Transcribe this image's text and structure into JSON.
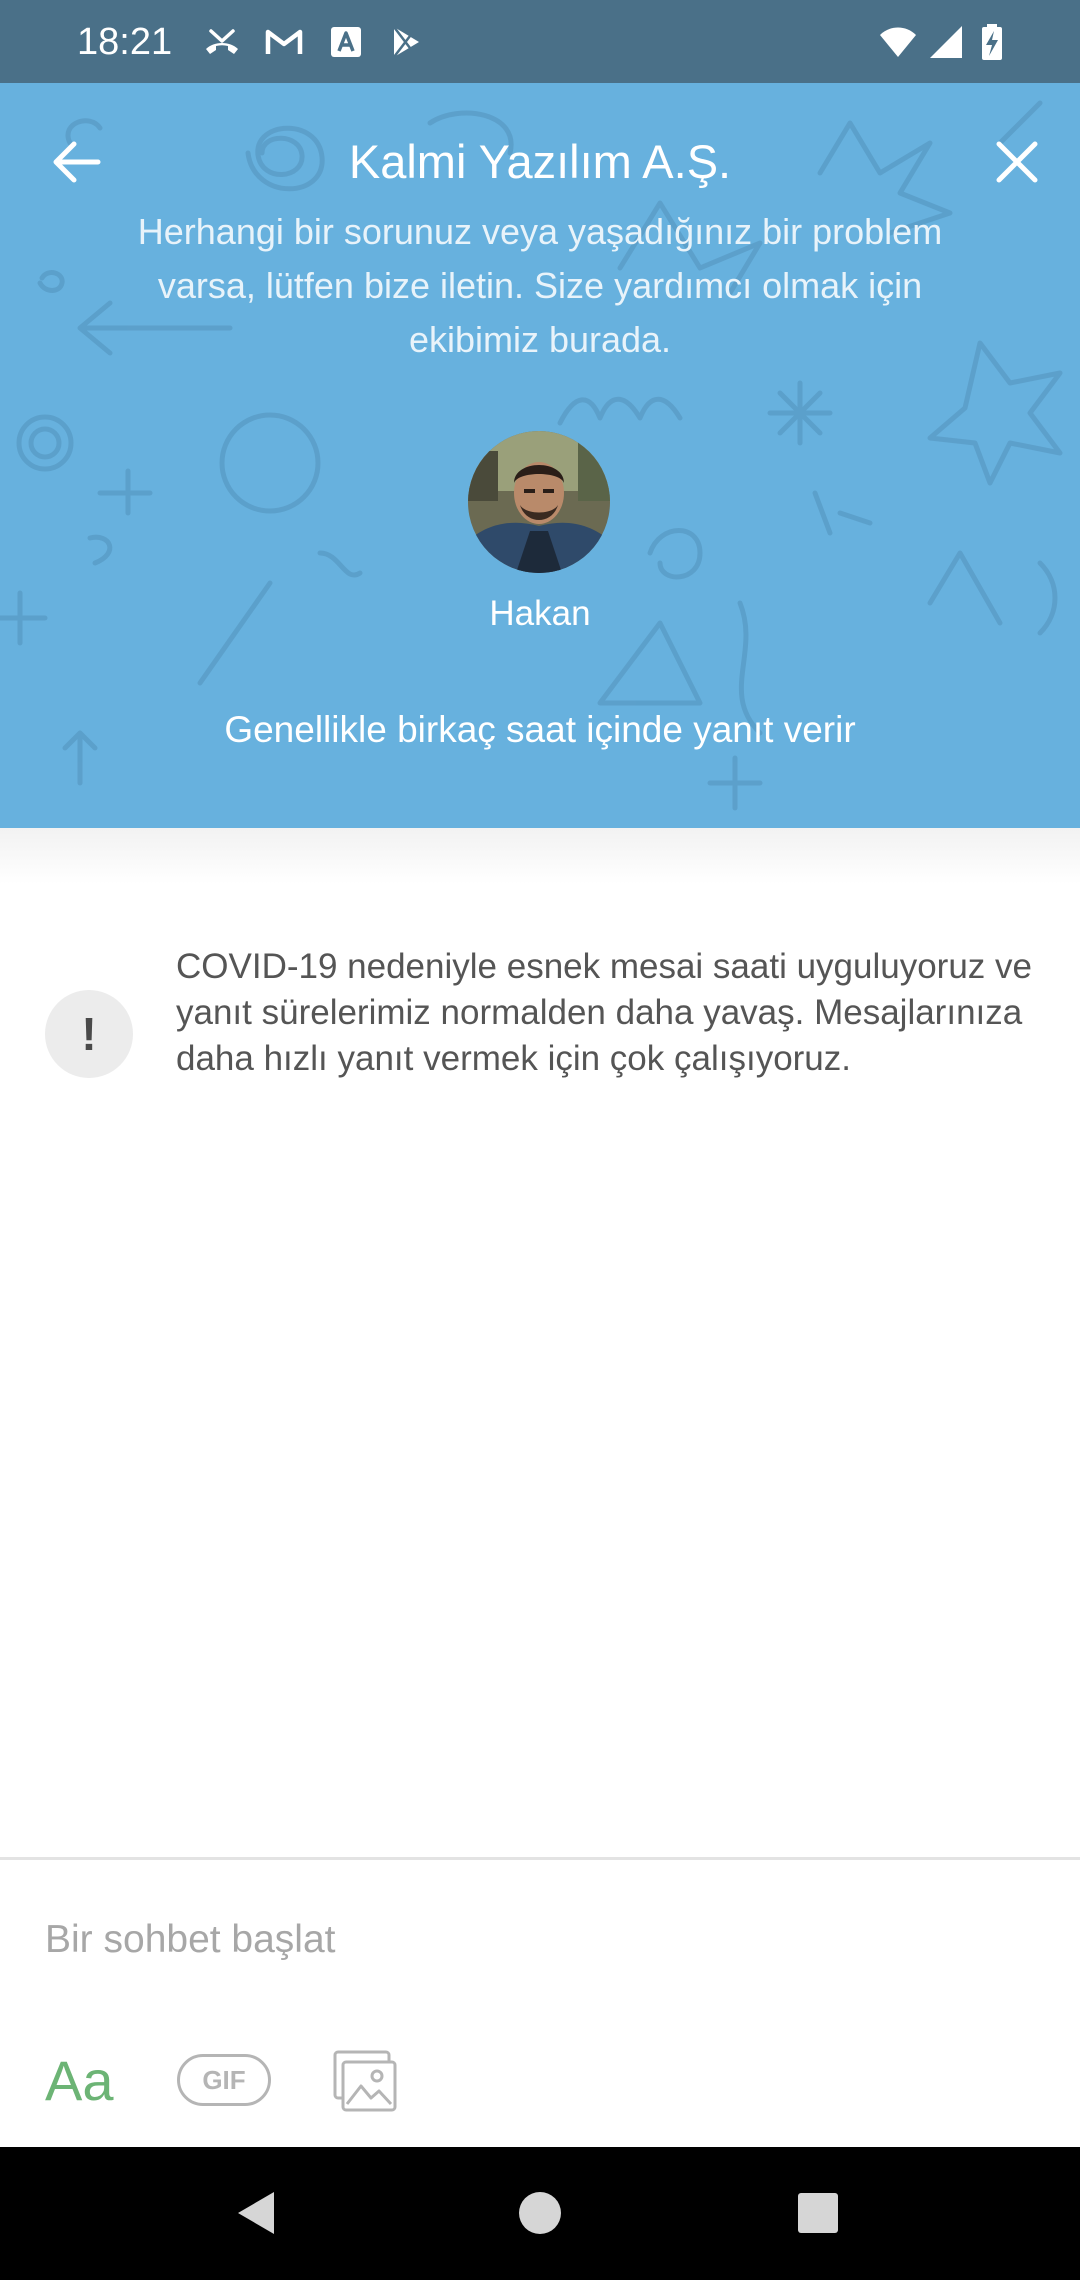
{
  "status_bar": {
    "time": "18:21",
    "left_icons": [
      "missed-call-icon",
      "gmail-icon",
      "app-store-icon",
      "play-store-icon"
    ],
    "right_icons": [
      "wifi-icon",
      "cellular-signal-icon",
      "battery-charging-icon"
    ]
  },
  "header": {
    "title": "Kalmi Yazılım A.Ş.",
    "subtitle": "Herhangi bir sorunuz veya yaşadığınız bir problem varsa, lütfen bize iletin. Size yardımcı olmak için ekibimiz burada.",
    "agent_name": "Hakan",
    "response_time": "Genellikle birkaç saat içinde yanıt verir",
    "background_color": "#67b1de"
  },
  "notice": {
    "icon_glyph": "!",
    "text": "COVID-19 nedeniyle esnek mesai saati uyguluyoruz ve yanıt sürelerimiz normalden daha yavaş. Mesajlarınıza daha hızlı yanıt vermek için çok çalışıyoruz."
  },
  "composer": {
    "placeholder": "Bir sohbet başlat",
    "value": "",
    "text_tool_label": "Aa",
    "gif_label": "GIF",
    "accent_color": "#6cb475"
  },
  "nav_bar": {
    "buttons": [
      "back-triangle-icon",
      "home-circle-icon",
      "recents-square-icon"
    ]
  }
}
